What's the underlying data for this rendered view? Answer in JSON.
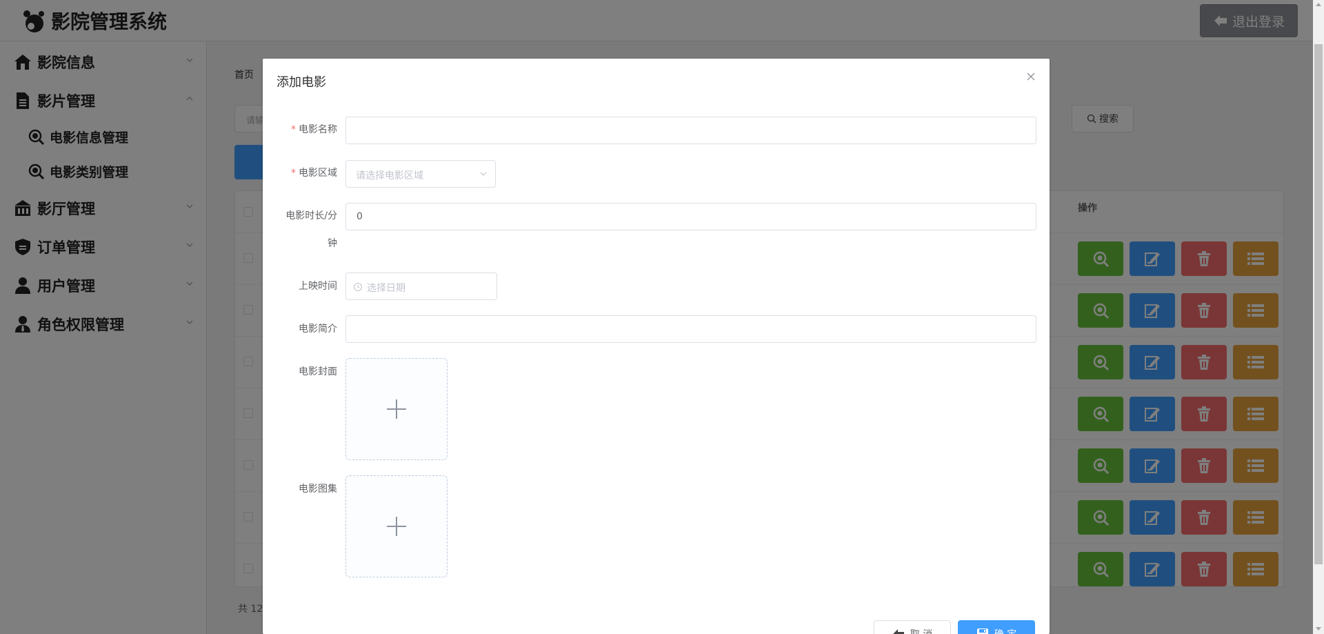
{
  "app": {
    "title": "影院管理系统",
    "logout_label": "退出登录"
  },
  "sidebar": {
    "items": [
      {
        "label": "影院信息",
        "expanded": false
      },
      {
        "label": "影片管理",
        "expanded": true,
        "children": [
          {
            "label": "电影信息管理"
          },
          {
            "label": "电影类别管理"
          }
        ]
      },
      {
        "label": "影厅管理",
        "expanded": false
      },
      {
        "label": "订单管理",
        "expanded": false
      },
      {
        "label": "用户管理",
        "expanded": false
      },
      {
        "label": "角色权限管理",
        "expanded": false
      }
    ]
  },
  "main": {
    "breadcrumb": "首页",
    "search_placeholder": "请输",
    "search_button": "搜索",
    "table": {
      "ops_header": "操作",
      "row_count": 7
    },
    "total_text": "共 12"
  },
  "dialog": {
    "title": "添加电影",
    "fields": {
      "name": {
        "label": "电影名称",
        "required": true,
        "value": ""
      },
      "region": {
        "label": "电影区域",
        "required": true,
        "placeholder": "请选择电影区域"
      },
      "duration": {
        "label_line1": "电影时长/分",
        "label_line2": "钟",
        "value": "0"
      },
      "release": {
        "label": "上映时间",
        "placeholder": "选择日期"
      },
      "intro": {
        "label": "电影简介",
        "value": ""
      },
      "cover": {
        "label": "电影封面"
      },
      "gallery": {
        "label": "电影图集"
      }
    },
    "buttons": {
      "cancel": "取 消",
      "confirm": "确 定"
    }
  },
  "colors": {
    "primary": "#409eff",
    "success": "#67c23a",
    "danger": "#f56c6c",
    "warning": "#e6a23c",
    "required": "#f56c6c"
  }
}
